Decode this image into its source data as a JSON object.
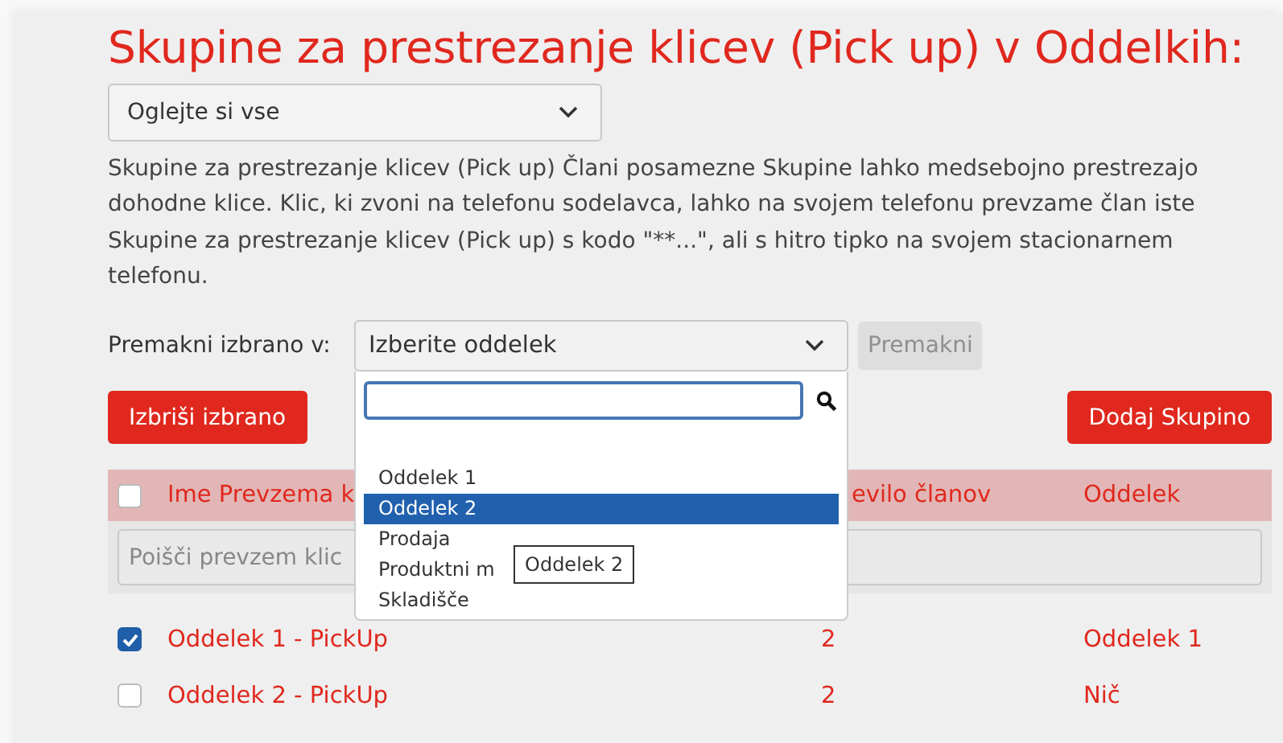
{
  "title": "Skupine za prestrezanje klicev (Pick up) v Oddelkih:",
  "view_select": {
    "value": "Oglejte si vse"
  },
  "description": "Skupine za prestrezanje klicev (Pick up) Člani posamezne Skupine lahko medsebojno prestrezajo dohodne klice. Klic, ki zvoni na telefonu sodelavca, lahko na svojem telefonu prevzame član iste Skupine za prestrezanje klicev (Pick up) s kodo \"**...\", ali s hitro tipko na svojem stacionarnem telefonu.",
  "move": {
    "label": "Premakni izbrano v:",
    "select_value": "Izberite oddelek",
    "button": "Premakni",
    "button_disabled": true,
    "dropdown": {
      "options": [
        {
          "label": "Oddelek 1",
          "selected": false
        },
        {
          "label": "Oddelek 2",
          "selected": true
        },
        {
          "label": "Prodaja",
          "selected": false
        },
        {
          "label": "Produktni m",
          "selected": false
        },
        {
          "label": "Skladišče",
          "selected": false
        }
      ],
      "tooltip": "Oddelek 2"
    }
  },
  "delete_button": "Izbriši izbrano",
  "add_button": "Dodaj Skupino",
  "table": {
    "header_checked": false,
    "columns": [
      "Ime Prevzema k",
      "evilo članov",
      "Oddelek"
    ],
    "filter_placeholder": "Poišči prevzem klic",
    "rows": [
      {
        "checked": true,
        "name": "Oddelek 1 - PickUp",
        "members": "2",
        "department": "Oddelek 1"
      },
      {
        "checked": false,
        "name": "Oddelek 2 - PickUp",
        "members": "2",
        "department": "Nič"
      }
    ]
  }
}
